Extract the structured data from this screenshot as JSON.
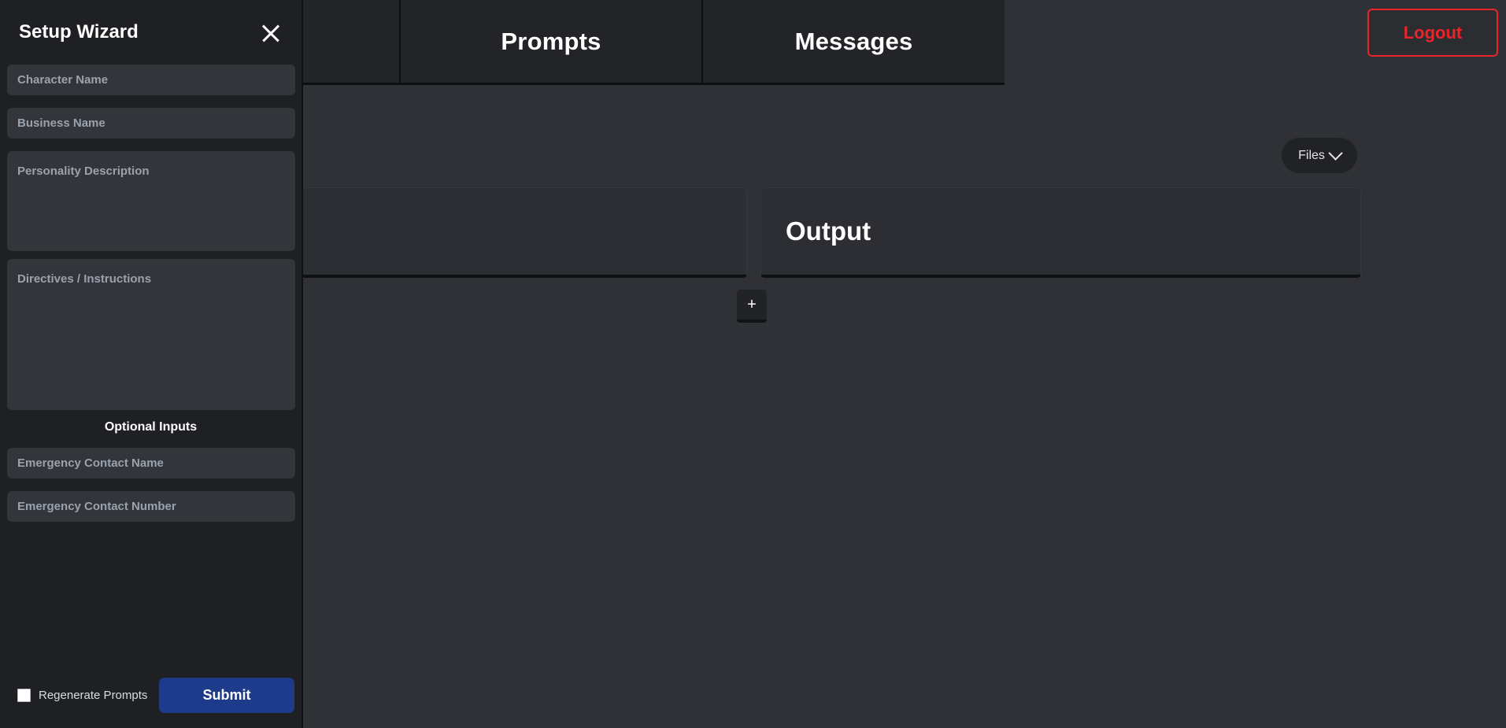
{
  "app": {
    "background_color": "#2f3136",
    "panel_color": "#2c2e33",
    "accent_blue": "#1e3a8a",
    "accent_red": "#e8252a"
  },
  "topbar": {
    "tabs": [
      {
        "label": "",
        "name": "tab-hidden"
      },
      {
        "label": "Prompts",
        "name": "tab-prompts"
      },
      {
        "label": "Messages",
        "name": "tab-messages"
      }
    ],
    "logout_label": "Logout"
  },
  "toolbar": {
    "files_label": "Files",
    "files_icon": "chevron-down-icon"
  },
  "main": {
    "left_panel_title": "",
    "output_panel_title": "Output",
    "add_button_label": "+"
  },
  "wizard": {
    "title": "Setup Wizard",
    "close_icon": "close-icon",
    "fields": [
      {
        "label": "Character Name",
        "value": "",
        "name": "character-name-field"
      },
      {
        "label": "Business Name",
        "value": "",
        "name": "business-name-field"
      },
      {
        "label": "Personality Description",
        "value": "",
        "name": "personality-description-field"
      },
      {
        "label": "Directives / Instructions",
        "value": "",
        "name": "directives-instructions-field"
      }
    ],
    "optional_heading": "Optional Inputs",
    "optional_fields": [
      {
        "label": "Emergency Contact Name",
        "value": "",
        "name": "emergency-contact-name-field"
      },
      {
        "label": "Emergency Contact Number",
        "value": "",
        "name": "emergency-contact-number-field"
      }
    ],
    "regenerate_label": "Regenerate Prompts",
    "regenerate_checked": false,
    "submit_label": "Submit"
  }
}
